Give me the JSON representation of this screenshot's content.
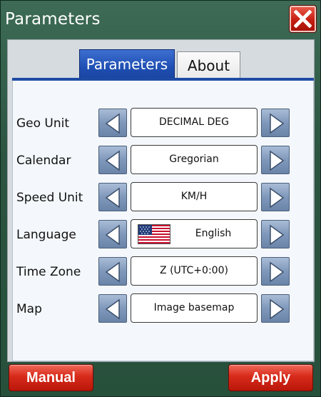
{
  "window": {
    "title": "Parameters"
  },
  "tabs": [
    {
      "label": "Parameters",
      "active": true
    },
    {
      "label": "About",
      "active": false
    }
  ],
  "rows": [
    {
      "label": "Geo Unit",
      "value": "DECIMAL DEG"
    },
    {
      "label": "Calendar",
      "value": "Gregorian"
    },
    {
      "label": "Speed Unit",
      "value": "KM/H"
    },
    {
      "label": "Language",
      "value": "English",
      "icon": "us-flag-icon"
    },
    {
      "label": "Time Zone",
      "value": "Z (UTC+0:00)"
    },
    {
      "label": "Map",
      "value": "Image basemap"
    }
  ],
  "buttons": {
    "manual": "Manual",
    "apply": "Apply"
  },
  "colors": {
    "accent": "#1f4fb3",
    "danger": "#d72a1a",
    "background": "#2f5a45"
  }
}
